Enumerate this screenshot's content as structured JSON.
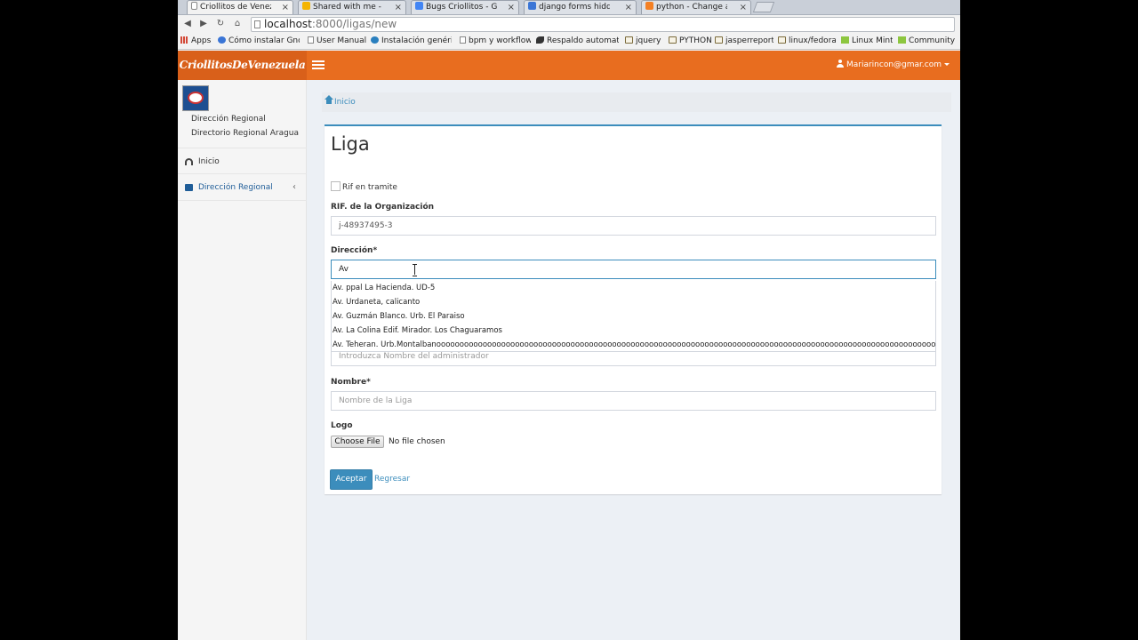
{
  "browser": {
    "tabs": [
      {
        "title": "Criollitos de Venezuela",
        "icon": "page-icon",
        "color": "#ffffff"
      },
      {
        "title": "Shared with me - Goog",
        "icon": "drive-icon",
        "color": "#f4b400"
      },
      {
        "title": "Bugs Criollitos - Google",
        "icon": "docs-icon",
        "color": "#4285f4"
      },
      {
        "title": "django forms hidden fi",
        "icon": "google-icon",
        "color": "#4285f4"
      },
      {
        "title": "python - Change a dja",
        "icon": "stackoverflow-icon",
        "color": "#f48024"
      }
    ],
    "url_host": "localhost",
    "url_rest": ":8000/ligas/new",
    "bookmarks": [
      {
        "label": "Apps",
        "icon": "apps-icon"
      },
      {
        "label": "Cómo instalar Gnom",
        "icon": "google-icon"
      },
      {
        "label": "User Manual",
        "icon": "page-icon"
      },
      {
        "label": "Instalación genéric",
        "icon": "globe-icon"
      },
      {
        "label": "bpm y workflow",
        "icon": "page-icon"
      },
      {
        "label": "Respaldo automatic",
        "icon": "feather-icon"
      },
      {
        "label": "jquery",
        "icon": "folder-icon"
      },
      {
        "label": "PYTHON",
        "icon": "folder-icon"
      },
      {
        "label": "jasperreport",
        "icon": "folder-icon"
      },
      {
        "label": "linux/fedora",
        "icon": "folder-icon"
      },
      {
        "label": "Linux Mint",
        "icon": "mint-icon"
      },
      {
        "label": "Community",
        "icon": "mint-icon"
      }
    ]
  },
  "header": {
    "brand": "CriollitosDeVenezuela",
    "user": "Mariarincon@gmar.com"
  },
  "sidebar": {
    "org_line1": "Dirección Regional",
    "org_line2": "Directorio Regional Aragua",
    "items": [
      {
        "label": "Inicio",
        "icon": "dashboard-icon"
      },
      {
        "label": "Dirección Regional",
        "icon": "folder-icon"
      }
    ]
  },
  "breadcrumb": {
    "home": "Inicio"
  },
  "form": {
    "title": "Liga",
    "rif_tramite_label": "Rif en tramite",
    "rif_label": "RIF. de la Organización",
    "rif_value": "j-48937495-3",
    "direccion_label": "Dirección*",
    "direccion_value": "Av",
    "suggestions": [
      "Av. ppal La Hacienda. UD-5",
      "Av.  Urdaneta, calicanto",
      "Av. Guzmán Blanco. Urb. El Paraiso",
      "Av. La Colina Edif. Mirador. Los Chaguaramos",
      "Av. Teheran. Urb.Montalbanooooooooooooooooooooooooooooooooooooooooooooooooooooooooooooooooooooooooooooooooooooooooooooooooooooooooooooooooooooooooo"
    ],
    "admin_placeholder": "Introduzca Nombre del administrador",
    "nombre_label": "Nombre*",
    "nombre_placeholder": "Nombre de la Liga",
    "logo_label": "Logo",
    "choose_file": "Choose File",
    "no_file": "No file chosen",
    "submit": "Aceptar",
    "back": "Regresar"
  },
  "colors": {
    "accent": "#e86d1f",
    "primary": "#3c8dbc"
  }
}
